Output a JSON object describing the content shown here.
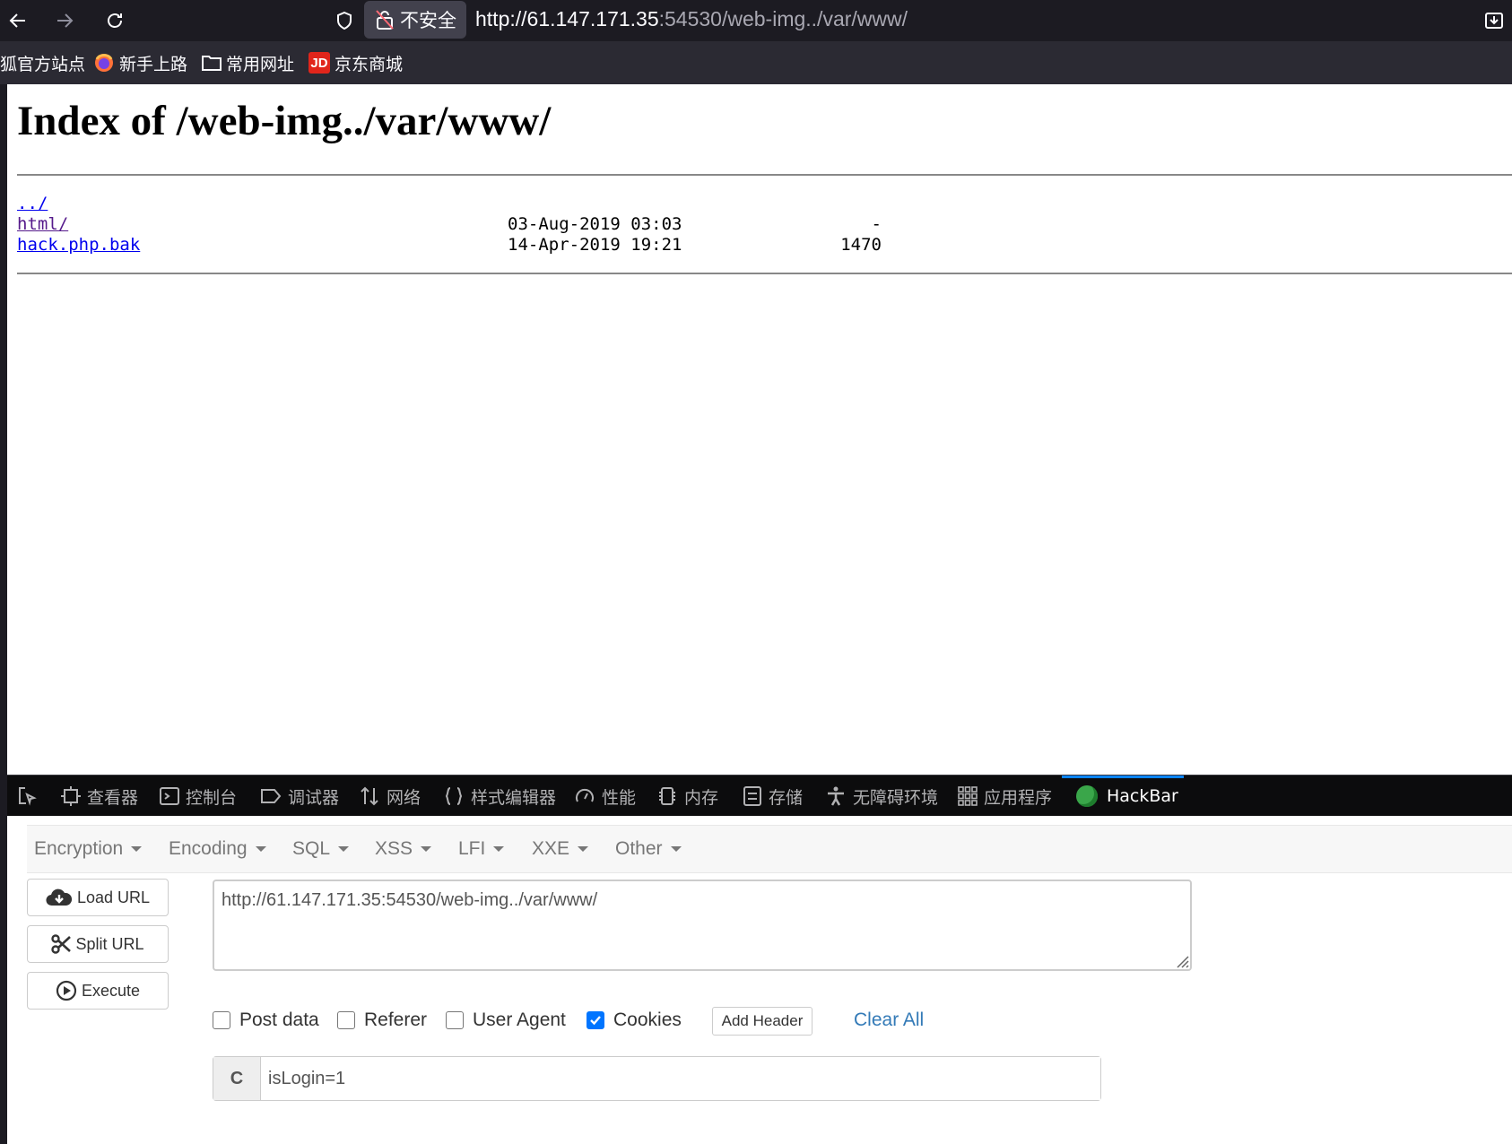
{
  "browser": {
    "security_label": "不安全",
    "url_host": "http://61.147.171.35",
    "url_rest": ":54530/web-img../var/www/"
  },
  "bookmarks": [
    {
      "label": "狐官方站点"
    },
    {
      "label": "新手上路"
    },
    {
      "label": "常用网址"
    },
    {
      "label": "京东商城",
      "badge": "JD"
    }
  ],
  "page": {
    "title": "Index of /web-img../var/www/",
    "entries": [
      {
        "name": "../",
        "date": "",
        "size": ""
      },
      {
        "name": "html/",
        "date": "03-Aug-2019 03:03",
        "size": "-"
      },
      {
        "name": "hack.php.bak",
        "date": "14-Apr-2019 19:21",
        "size": "1470"
      }
    ]
  },
  "devtools": {
    "tabs": [
      "查看器",
      "控制台",
      "调试器",
      "网络",
      "样式编辑器",
      "性能",
      "内存",
      "存储",
      "无障碍环境",
      "应用程序",
      "HackBar"
    ],
    "active_tab": "HackBar"
  },
  "hackbar": {
    "menus": [
      "Encryption",
      "Encoding",
      "SQL",
      "XSS",
      "LFI",
      "XXE",
      "Other"
    ],
    "buttons": {
      "load": "Load URL",
      "split": "Split URL",
      "execute": "Execute"
    },
    "url_value": "http://61.147.171.35:54530/web-img../var/www/",
    "options": [
      {
        "label": "Post data",
        "checked": false
      },
      {
        "label": "Referer",
        "checked": false
      },
      {
        "label": "User Agent",
        "checked": false
      },
      {
        "label": "Cookies",
        "checked": true
      }
    ],
    "add_header": "Add Header",
    "clear_all": "Clear All",
    "cookie_prefix": "C",
    "cookie_value": "isLogin=1"
  },
  "colors": {
    "accent": "#0a84ff",
    "link": "#0000ee",
    "checkbox": "#0075ff"
  }
}
